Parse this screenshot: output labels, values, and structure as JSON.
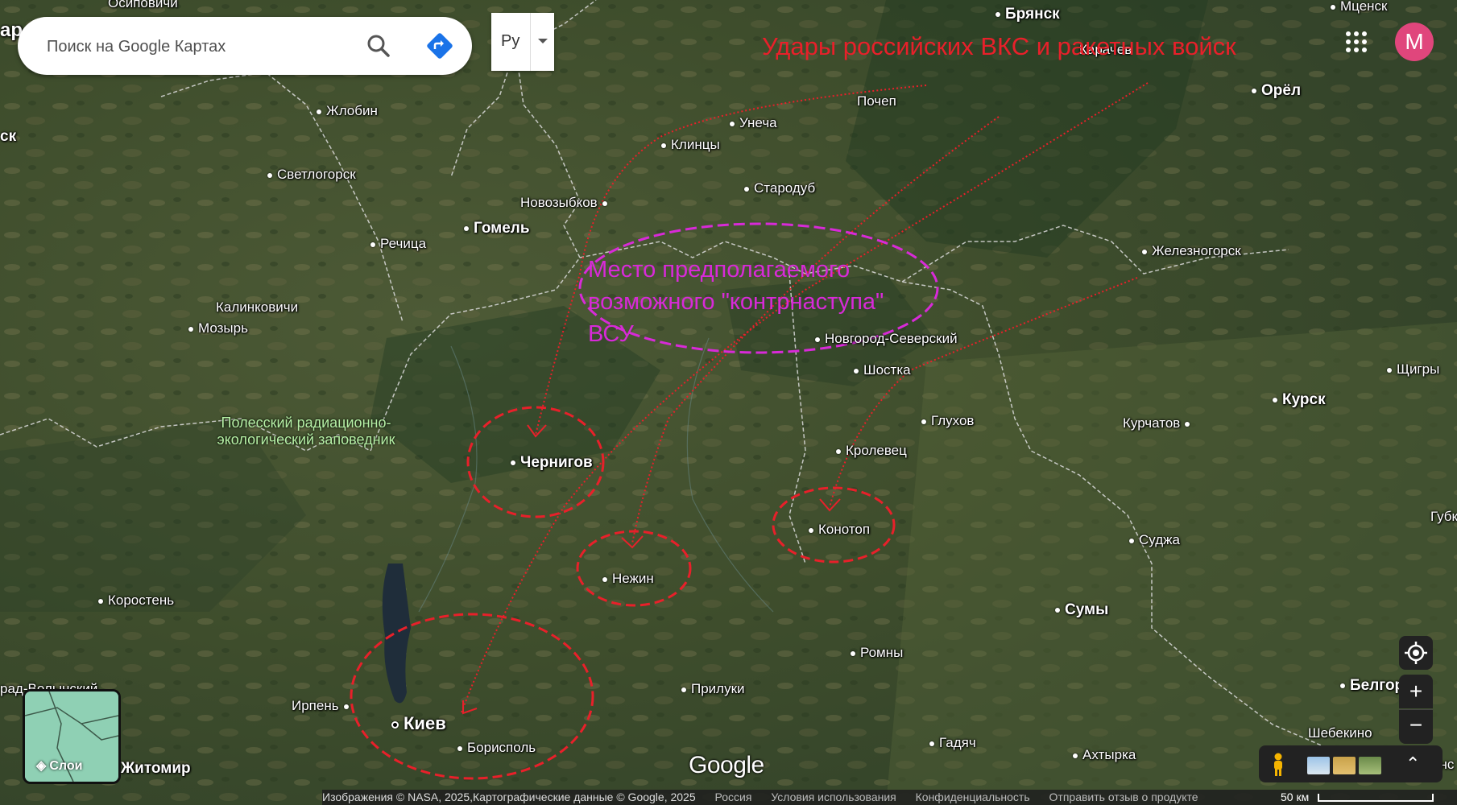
{
  "search": {
    "placeholder": "Поиск на Google Картах"
  },
  "language_button": {
    "label": "Ру"
  },
  "account": {
    "initial": "M"
  },
  "annotations": {
    "title": "Удары российских ВКС и ракетных войск",
    "region_label": "Место предполагаемого возможного \"контрнаступа\" ВСУ"
  },
  "map_labels": {
    "osipovichi": "Осиповичи",
    "bryansk": "Брянск",
    "mtsensk": "Мценск",
    "karachev": "Карачев",
    "orel": "Орёл",
    "zhlobin": "Жлобин",
    "pochep": "Почеп",
    "unecha": "Унеча",
    "klintsy": "Клинцы",
    "svetlogorsk": "Светлогорск",
    "novozybkov": "Новозыбков",
    "starodub": "Стародуб",
    "gomel": "Гомель",
    "rechitsa": "Речица",
    "zheleznogorsk": "Железногорск",
    "kalinkovichi": "Калинковичи",
    "mozyr": "Мозырь",
    "novgorod_seversky": "Новгород-Северский",
    "shostka": "Шостка",
    "shchigry": "Щигры",
    "kursk": "Курск",
    "glukhov": "Глухов",
    "kurchatov": "Курчатов",
    "chernigov": "Чернигов",
    "krolevets": "Кролевец",
    "konotop": "Конотоп",
    "gubkin": "Губк",
    "sudzha": "Суджа",
    "nezhin": "Нежин",
    "korosten": "Коростень",
    "sumy": "Сумы",
    "romny": "Ромны",
    "priluki": "Прилуки",
    "belgorod": "Белгор",
    "irpen": "Ирпень",
    "kiev": "Киев",
    "boryspil": "Борисполь",
    "gadyach": "Гадяч",
    "akhtyrka": "Ахтырка",
    "shebekino": "Шебекино",
    "zhitomir": "Житомир",
    "novograd_volynsky": "рад-Волынский",
    "left_edge_1": "ар",
    "left_edge_2": "ск",
    "right_edge": "анс",
    "polesie_reserve": "Полесский радиационно-экологический заповедник"
  },
  "layers_button": {
    "label": "Слои"
  },
  "google_logo": "Google",
  "footer": {
    "attribution": "Изображения © NASA, 2025,Картографические данные © Google, 2025",
    "country": "Россия",
    "terms": "Условия использования",
    "privacy": "Конфиденциальность",
    "feedback": "Отправить отзыв о продукте",
    "scale": "50 км"
  },
  "colors": {
    "strike_lines": "#e8202a",
    "region_ellipse": "#d82ad8",
    "avatar_bg": "#e0467c"
  }
}
